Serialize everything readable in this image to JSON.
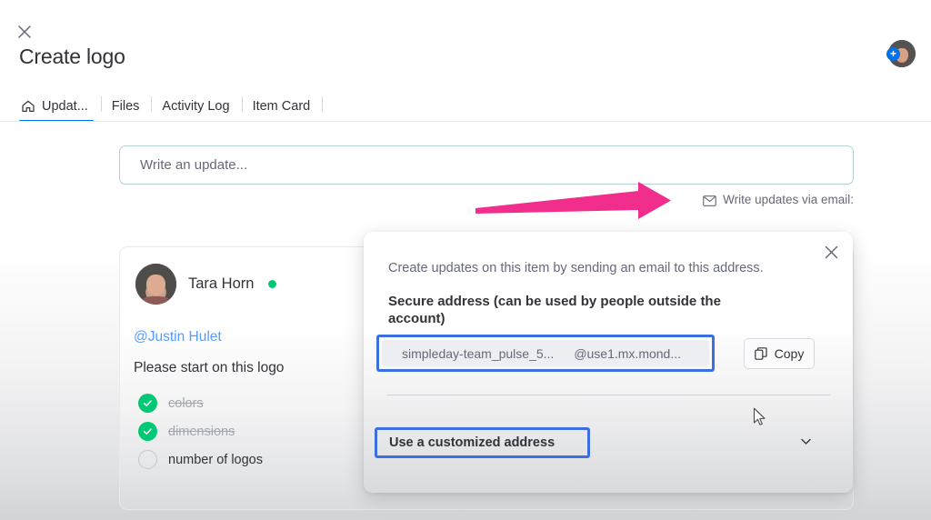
{
  "header": {
    "close_icon": "close-icon",
    "title": "Create logo",
    "avatar": {
      "icon": "avatar",
      "badge": "+"
    }
  },
  "tabs": [
    {
      "label": "Updat...",
      "icon": "home-icon",
      "active": true
    },
    {
      "label": "Files",
      "active": false
    },
    {
      "label": "Activity Log",
      "active": false
    },
    {
      "label": "Item Card",
      "active": false
    }
  ],
  "composer": {
    "placeholder": "Write an update...",
    "email_link_label": "Write updates via email:",
    "mail_icon": "mail-icon"
  },
  "annotation": {
    "arrow_color": "#f12e8c",
    "arrow_name": "pink-annotation-arrow"
  },
  "update": {
    "author": "Tara Horn",
    "online_status_color": "#00c875",
    "mention": "@Justin Hulet",
    "body": "Please start on this logo",
    "checklist": [
      {
        "label": "colors",
        "checked": true
      },
      {
        "label": "dimensions",
        "checked": true
      },
      {
        "label": "number of logos",
        "checked": false
      }
    ]
  },
  "email_popup": {
    "close_icon": "close-icon",
    "description": "Create updates on this item by sending an email to this address.",
    "heading": "Secure address (can be used by people outside the account)",
    "address_local": "simpleday-team_pulse_5...",
    "address_domain": "@use1.mx.mond...",
    "copy_label": "Copy",
    "copy_icon": "copy-icon",
    "customized_label": "Use a customized address",
    "chevron_icon": "chevron-down-icon",
    "highlight_color": "#3b6fe0"
  },
  "cursor": {
    "icon": "mouse-pointer"
  }
}
